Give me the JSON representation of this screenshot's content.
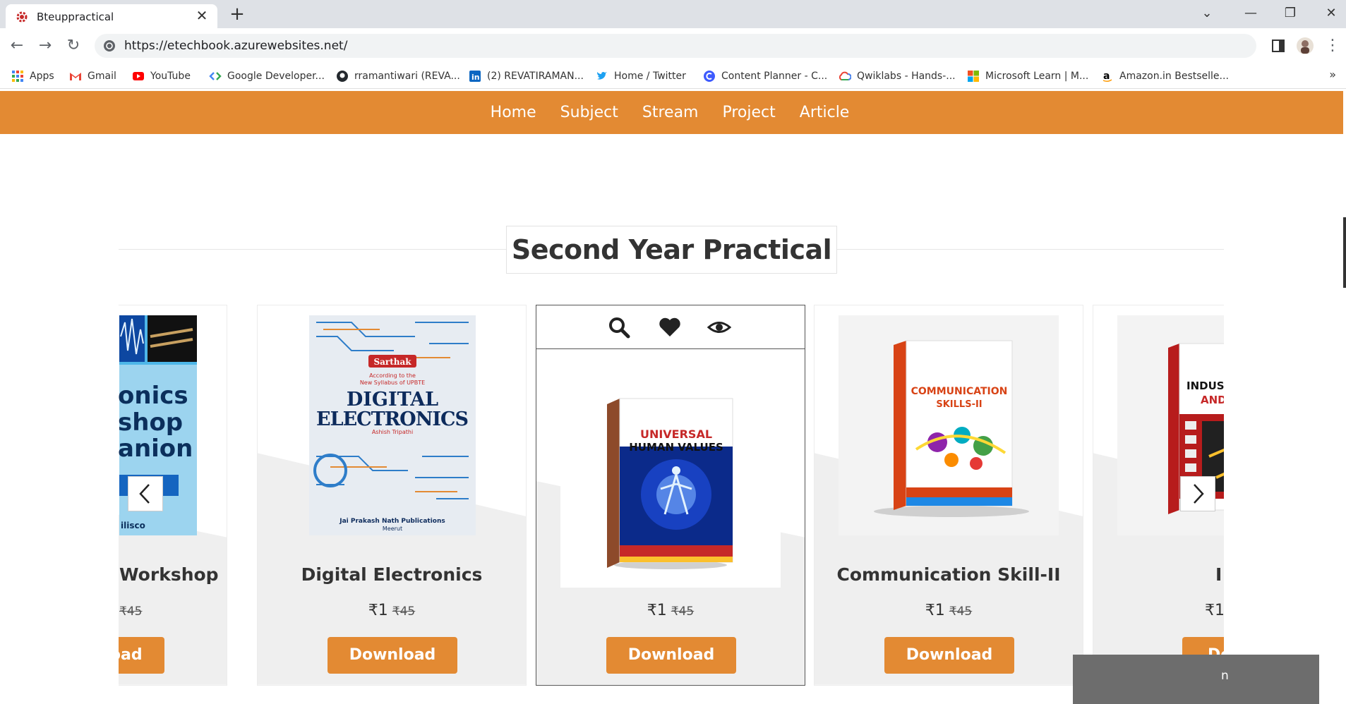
{
  "browser": {
    "tab_title": "Bteuppractical",
    "tab_close": "✕",
    "new_tab": "+",
    "url": "https://etechbook.azurewebsites.net/",
    "bookmarks": [
      {
        "label": "Apps",
        "icon": "apps-grid-icon",
        "color": "#4285f4"
      },
      {
        "label": "Gmail",
        "icon": "gmail-icon",
        "color": "#ea4335"
      },
      {
        "label": "YouTube",
        "icon": "youtube-icon",
        "color": "#ff0000"
      },
      {
        "label": "Google Developer...",
        "icon": "google-developers-icon",
        "color": "#4285f4"
      },
      {
        "label": "rramantiwari (REVA...",
        "icon": "github-icon",
        "color": "#24292e"
      },
      {
        "label": "(2) REVATIRAMAN...",
        "icon": "linkedin-icon",
        "color": "#0a66c2"
      },
      {
        "label": "Home / Twitter",
        "icon": "twitter-icon",
        "color": "#1da1f2"
      },
      {
        "label": "Content Planner - C...",
        "icon": "content-planner-icon",
        "color": "#3d5afe"
      },
      {
        "label": "Qwiklabs - Hands-...",
        "icon": "google-cloud-icon",
        "color": "#fbbc04"
      },
      {
        "label": "Microsoft Learn | M...",
        "icon": "microsoft-icon",
        "color": "#f25022"
      },
      {
        "label": "Amazon.in Bestselle...",
        "icon": "amazon-icon",
        "color": "#000000"
      }
    ],
    "bookmarks_more": "»"
  },
  "site_nav": {
    "links": [
      "Home",
      "Subject",
      "Stream",
      "Project",
      "Article"
    ],
    "bg_color": "#e38a33"
  },
  "section": {
    "title": "Second Year Practical"
  },
  "products": [
    {
      "name": "Workshop",
      "price": "₹1",
      "old_price": "₹45",
      "button": "Download"
    },
    {
      "name": "Digital Electronics",
      "price": "₹1",
      "old_price": "₹45",
      "button": "Download"
    },
    {
      "name": "",
      "price": "₹1",
      "old_price": "₹45",
      "button": "Download"
    },
    {
      "name": "Communication Skill-II",
      "price": "₹1",
      "old_price": "₹45",
      "button": "Download"
    },
    {
      "name": "I",
      "price": "₹1",
      "old_price": "",
      "button": "Dow"
    }
  ],
  "covers": {
    "workshop": [
      "onics",
      "shop",
      "anion",
      "ilisco"
    ],
    "digital": {
      "brand": "Sarthak",
      "note1": "According to the",
      "note2": "New Syllabus of UPBTE",
      "title1": "DIGITAL",
      "title2": "ELECTRONICS",
      "author": "Ashish Tripathi",
      "publisher": "Jai Prakash Nath Publications",
      "city": "Meerut"
    },
    "universal": {
      "title1": "UNIVERSAL",
      "title2": "HUMAN VALUES"
    },
    "communication": {
      "title1": "COMMUNICATION",
      "title2": "SKILLS-II"
    },
    "industrial": {
      "title1": "INDUSTRI",
      "title2": "AND T"
    }
  },
  "chat": {
    "label": "n"
  }
}
